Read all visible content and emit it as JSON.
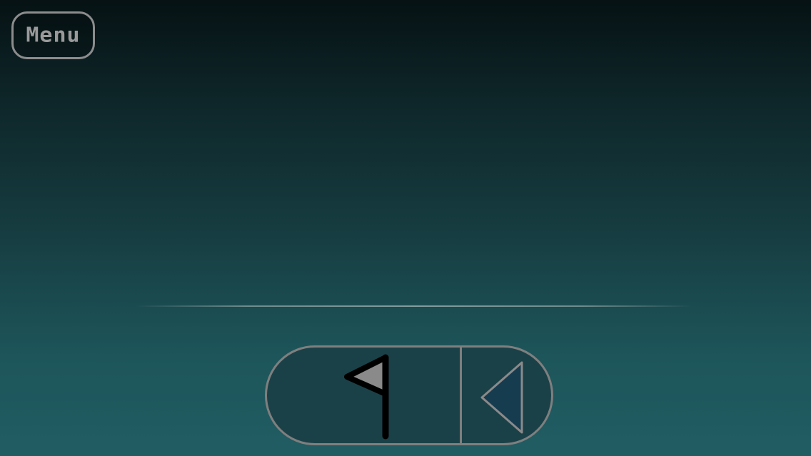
{
  "menu": {
    "label": "Menu"
  },
  "controls": {
    "left_icon": "flag-icon",
    "right_icon": "triangle-left-icon"
  },
  "colors": {
    "outline": "#7f7f7f",
    "bar_fill": "#1b4148",
    "flag_fill": "#8a8a8a",
    "triangle_fill": "#163c50"
  }
}
